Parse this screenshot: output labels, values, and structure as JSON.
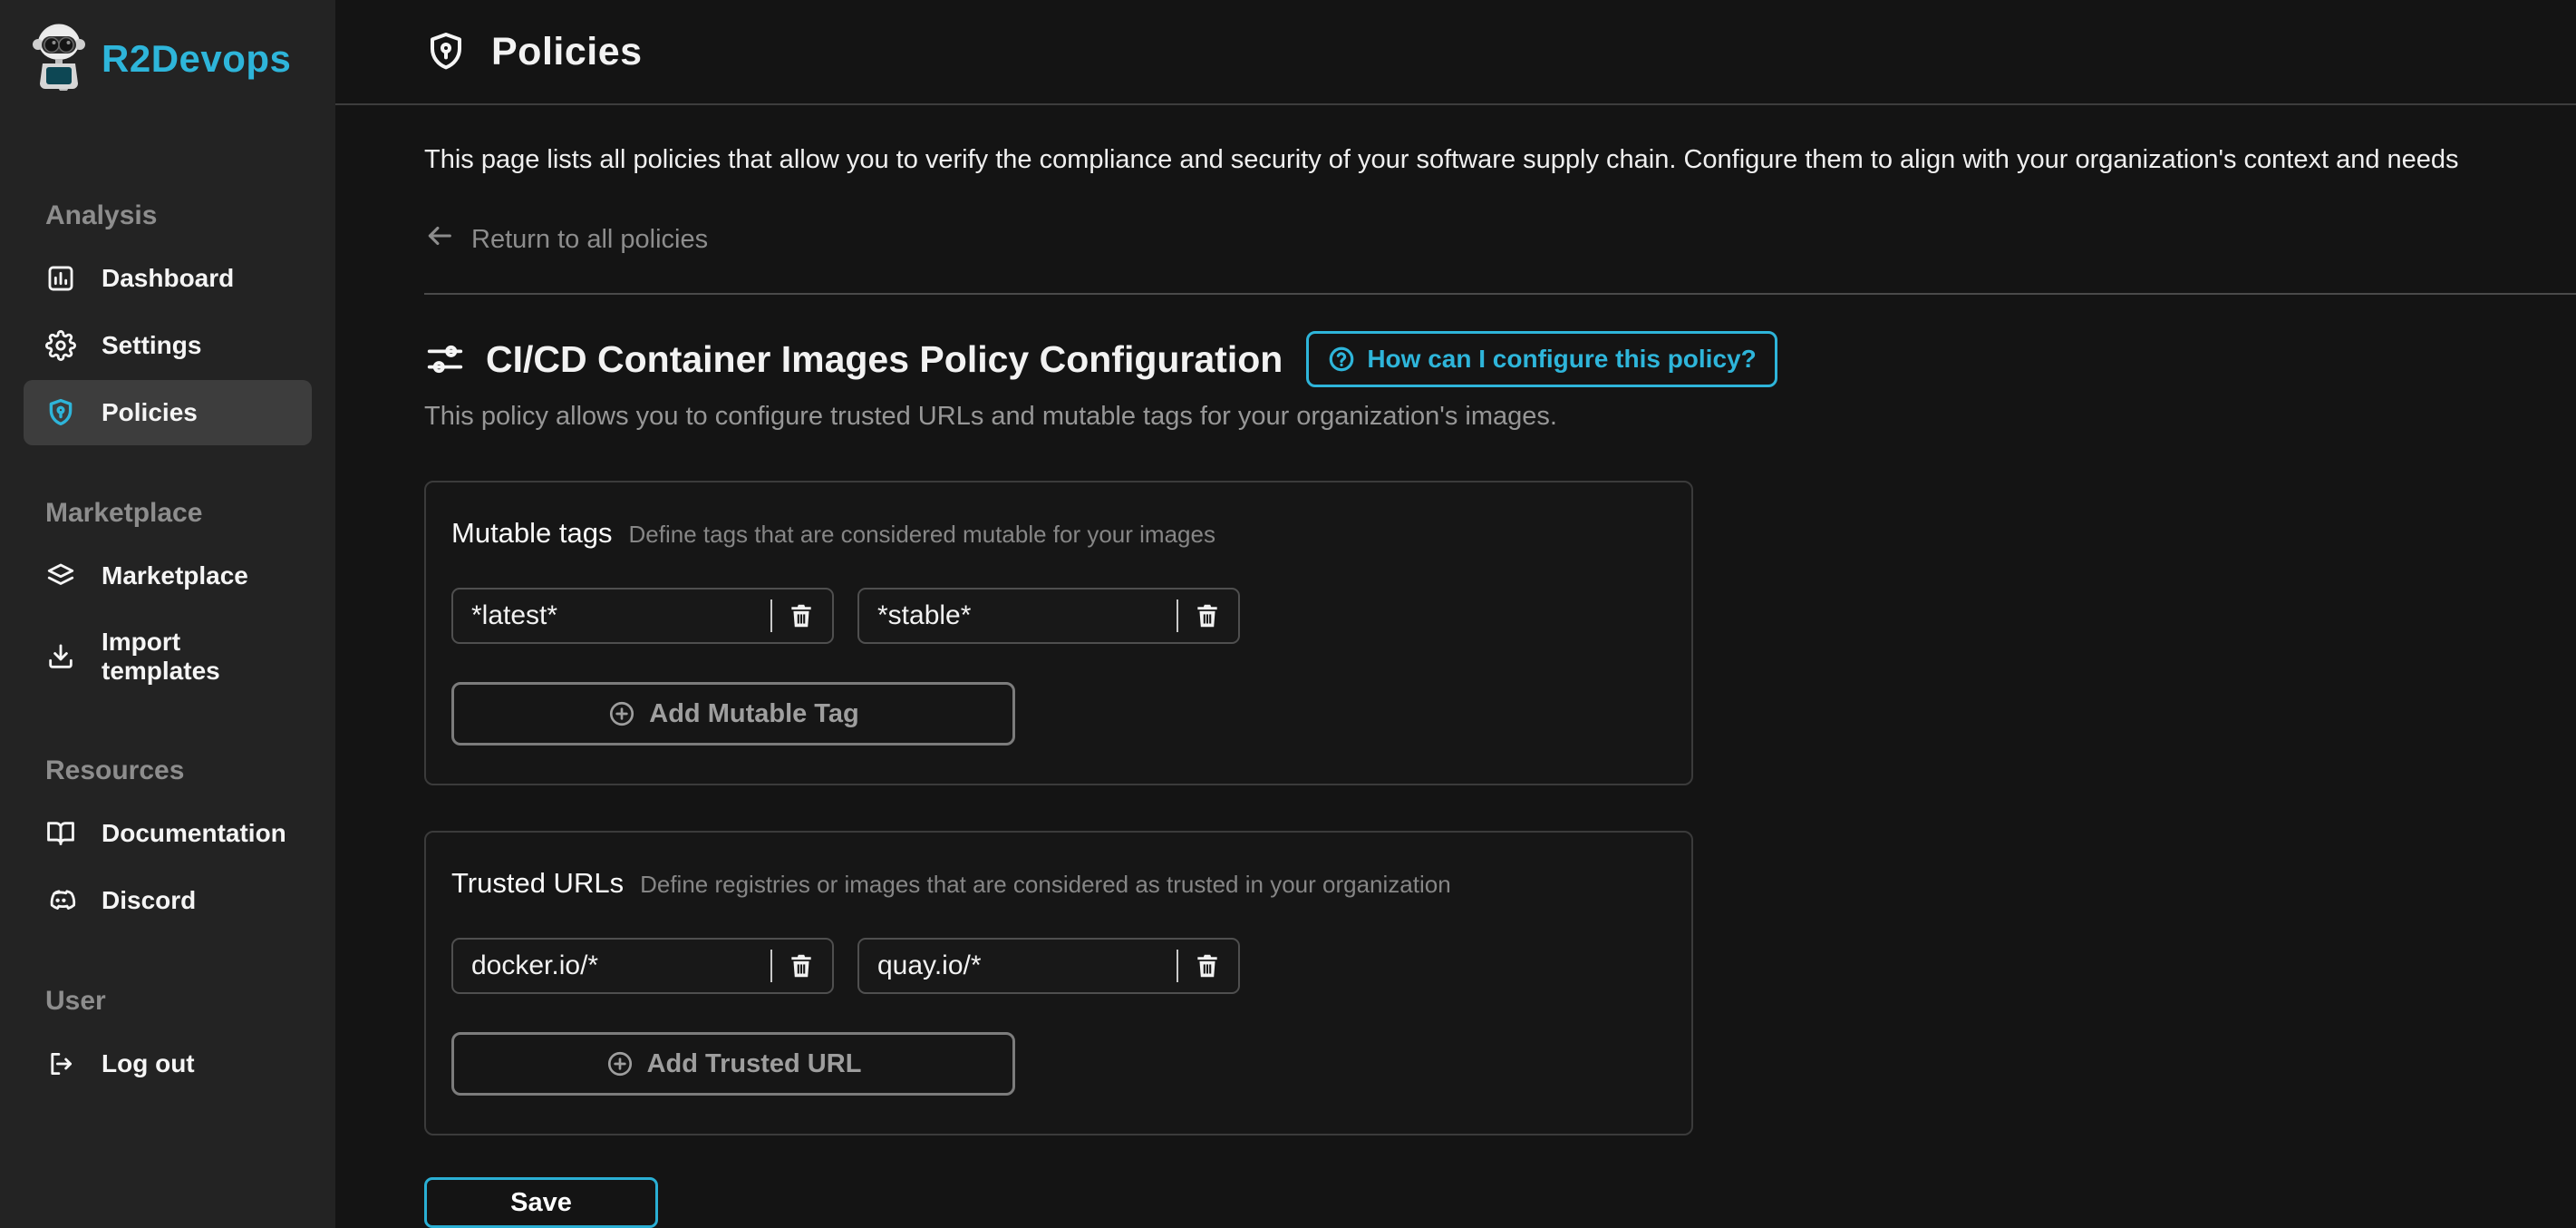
{
  "brand": {
    "name": "R2Devops",
    "accent_color": "#2eb5da"
  },
  "sidebar": {
    "sections": [
      {
        "label": "Analysis",
        "items": [
          {
            "label": "Dashboard",
            "icon": "dashboard-icon",
            "active": false
          },
          {
            "label": "Settings",
            "icon": "settings-icon",
            "active": false
          },
          {
            "label": "Policies",
            "icon": "shield-icon",
            "active": true
          }
        ]
      },
      {
        "label": "Marketplace",
        "items": [
          {
            "label": "Marketplace",
            "icon": "layers-icon",
            "active": false
          },
          {
            "label": "Import templates",
            "icon": "download-icon",
            "active": false
          }
        ]
      },
      {
        "label": "Resources",
        "items": [
          {
            "label": "Documentation",
            "icon": "book-icon",
            "active": false
          },
          {
            "label": "Discord",
            "icon": "discord-icon",
            "active": false
          }
        ]
      },
      {
        "label": "User",
        "items": [
          {
            "label": "Log out",
            "icon": "logout-icon",
            "active": false
          }
        ]
      }
    ]
  },
  "header": {
    "title": "Policies"
  },
  "main": {
    "description": "This page lists all policies that allow you to verify the compliance and security of your software supply chain. Configure them to align with your organization's context and needs",
    "back_link": "Return to all policies",
    "policy": {
      "heading": "CI/CD Container Images Policy Configuration",
      "help_button": "How can I configure this policy?",
      "subtitle": "This policy allows you to configure trusted URLs and mutable tags for your organization's images."
    },
    "cards": [
      {
        "title": "Mutable tags",
        "hint": "Define tags that are considered mutable for your images",
        "values": [
          "*latest*",
          "*stable*"
        ],
        "add_label": "Add Mutable Tag"
      },
      {
        "title": "Trusted URLs",
        "hint": "Define registries or images that are considered as trusted in your organization",
        "values": [
          "docker.io/*",
          "quay.io/*"
        ],
        "add_label": "Add Trusted URL"
      }
    ],
    "save_label": "Save"
  }
}
